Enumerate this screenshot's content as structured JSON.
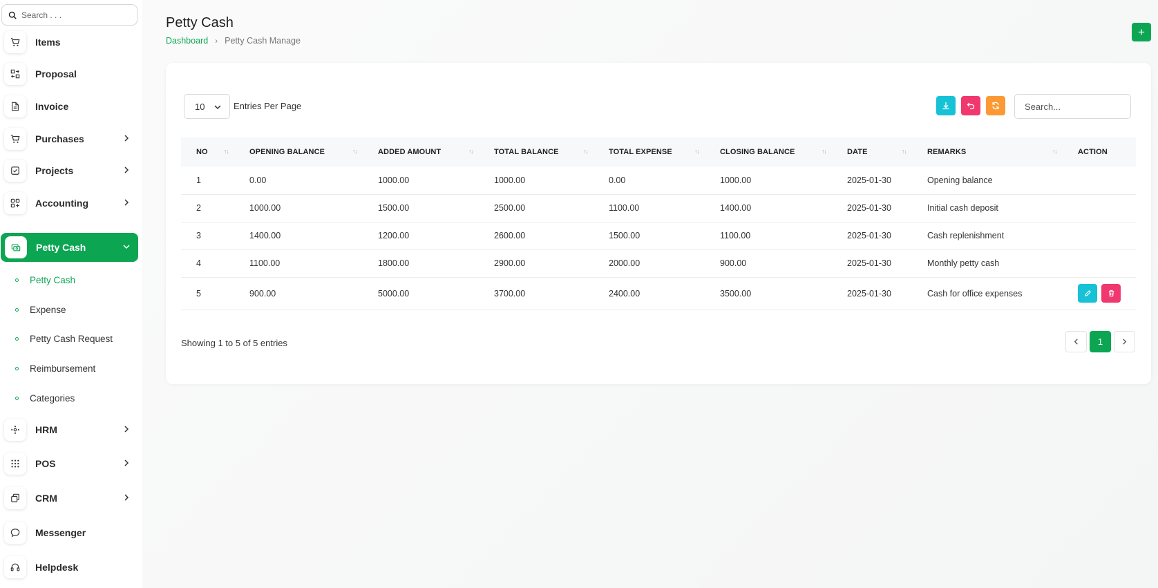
{
  "sidebar": {
    "search_placeholder": "Search . . .",
    "items": [
      {
        "label": "Items",
        "icon": "cart-icon",
        "has_children": false
      },
      {
        "label": "Proposal",
        "icon": "proposal-icon",
        "has_children": false
      },
      {
        "label": "Invoice",
        "icon": "file-icon",
        "has_children": false
      },
      {
        "label": "Purchases",
        "icon": "cart-icon",
        "has_children": true
      },
      {
        "label": "Projects",
        "icon": "check-square-icon",
        "has_children": true
      },
      {
        "label": "Accounting",
        "icon": "apps-icon",
        "has_children": true
      },
      {
        "label": "Petty Cash",
        "icon": "cash-icon",
        "has_children": true,
        "expanded": true
      },
      {
        "label": "HRM",
        "icon": "hrm-icon",
        "has_children": true
      },
      {
        "label": "POS",
        "icon": "grid-dots-icon",
        "has_children": true
      },
      {
        "label": "CRM",
        "icon": "copy-icon",
        "has_children": true
      },
      {
        "label": "Messenger",
        "icon": "chat-icon",
        "has_children": false
      },
      {
        "label": "Helpdesk",
        "icon": "headset-icon",
        "has_children": false
      }
    ],
    "submenu": [
      {
        "label": "Petty Cash",
        "current": true
      },
      {
        "label": "Expense"
      },
      {
        "label": "Petty Cash Request"
      },
      {
        "label": "Reimbursement"
      },
      {
        "label": "Categories"
      }
    ]
  },
  "header": {
    "title": "Petty Cash",
    "breadcrumb": {
      "home": "Dashboard",
      "separator": "›",
      "current": "Petty Cash Manage"
    },
    "add_label": "+"
  },
  "table_controls": {
    "entries_value": "10",
    "entries_label": "Entries Per Page",
    "search_placeholder": "Search..."
  },
  "table": {
    "columns": [
      "NO",
      "OPENING BALANCE",
      "ADDED AMOUNT",
      "TOTAL BALANCE",
      "TOTAL EXPENSE",
      "CLOSING BALANCE",
      "DATE",
      "REMARKS",
      "ACTION"
    ],
    "sort_glyph": "↑↓",
    "rows": [
      {
        "no": "1",
        "opening": "0.00",
        "added": "1000.00",
        "total": "1000.00",
        "expense": "0.00",
        "closing": "1000.00",
        "date": "2025-01-30",
        "remarks": "Opening balance",
        "actions": false
      },
      {
        "no": "2",
        "opening": "1000.00",
        "added": "1500.00",
        "total": "2500.00",
        "expense": "1100.00",
        "closing": "1400.00",
        "date": "2025-01-30",
        "remarks": "Initial cash deposit",
        "actions": false
      },
      {
        "no": "3",
        "opening": "1400.00",
        "added": "1200.00",
        "total": "2600.00",
        "expense": "1500.00",
        "closing": "1100.00",
        "date": "2025-01-30",
        "remarks": "Cash replenishment",
        "actions": false
      },
      {
        "no": "4",
        "opening": "1100.00",
        "added": "1800.00",
        "total": "2900.00",
        "expense": "2000.00",
        "closing": "900.00",
        "date": "2025-01-30",
        "remarks": "Monthly petty cash",
        "actions": false
      },
      {
        "no": "5",
        "opening": "900.00",
        "added": "5000.00",
        "total": "3700.00",
        "expense": "2400.00",
        "closing": "3500.00",
        "date": "2025-01-30",
        "remarks": "Cash for office expenses",
        "actions": true
      }
    ]
  },
  "footer": {
    "showing": "Showing 1 to 5 of 5 entries",
    "current_page": "1"
  },
  "colors": {
    "brand": "#0ca653",
    "info": "#17c1d6",
    "danger": "#f0386f",
    "warning": "#fb9a34"
  }
}
